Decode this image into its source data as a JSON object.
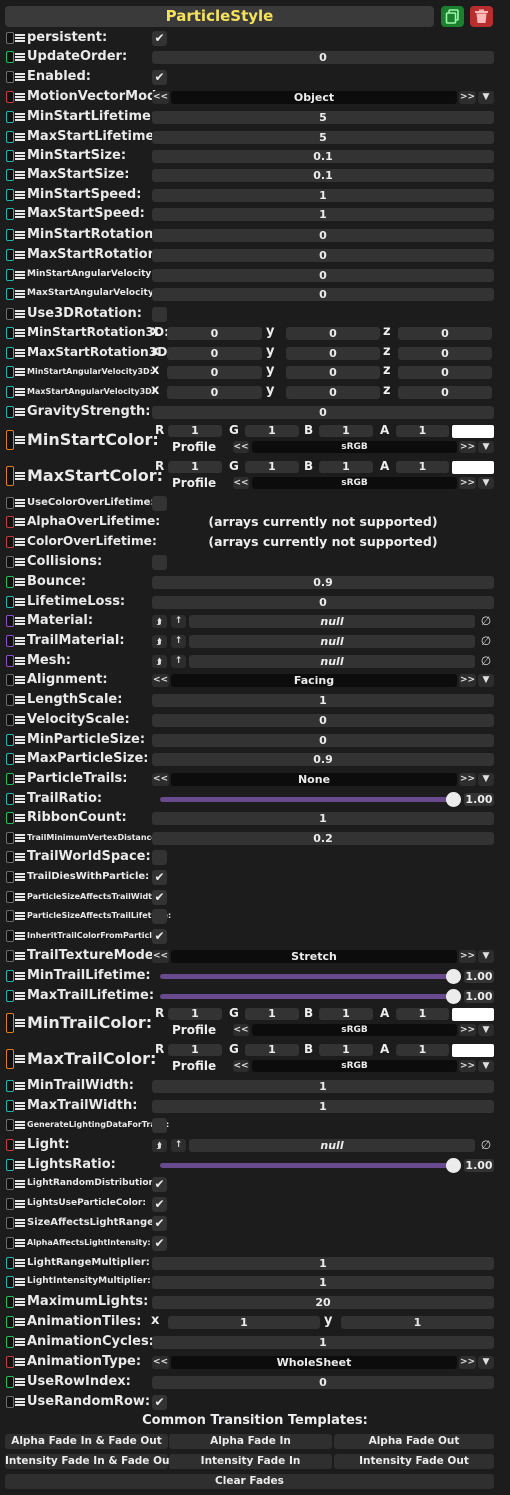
{
  "header": {
    "title": "ParticleStyle"
  },
  "toggle_colors": {
    "green": "#1fbe5a",
    "cyan": "#21b6b0",
    "red": "#c53a3a",
    "purple": "#8e4fcc",
    "orange": "#e07c1c",
    "gray": "#6c6c6c",
    "title_yellow": "#f5e25a"
  },
  "rows": [
    {
      "type": "check",
      "label": "persistent:",
      "checked": true
    },
    {
      "type": "field",
      "label": "UpdateOrder:",
      "value": "0"
    },
    {
      "type": "check",
      "label": "Enabled:",
      "checked": true
    },
    {
      "type": "dropdown",
      "label": "MotionVectorMode:",
      "value": "Object"
    },
    {
      "type": "field",
      "label": "MinStartLifetime:",
      "value": "5"
    },
    {
      "type": "field",
      "label": "MaxStartLifetime:",
      "value": "5"
    },
    {
      "type": "field",
      "label": "MinStartSize:",
      "value": "0.1"
    },
    {
      "type": "field",
      "label": "MaxStartSize:",
      "value": "0.1"
    },
    {
      "type": "field",
      "label": "MinStartSpeed:",
      "value": "1"
    },
    {
      "type": "field",
      "label": "MaxStartSpeed:",
      "value": "1"
    },
    {
      "type": "field",
      "label": "MinStartRotation:",
      "value": "0"
    },
    {
      "type": "field",
      "label": "MaxStartRotation:",
      "value": "0"
    },
    {
      "type": "field",
      "label": "MinStartAngularVelocity:",
      "value": "0"
    },
    {
      "type": "field",
      "label": "MaxStartAngularVelocity:",
      "value": "0"
    },
    {
      "type": "check",
      "label": "Use3DRotation:",
      "checked": false
    },
    {
      "type": "vec3",
      "label": "MinStartRotation3D:",
      "x": "0",
      "y": "0",
      "z": "0"
    },
    {
      "type": "vec3",
      "label": "MaxStartRotation3D:",
      "x": "0",
      "y": "0",
      "z": "0"
    },
    {
      "type": "vec3",
      "label": "MinStartAngularVelocity3D:",
      "x": "0",
      "y": "0",
      "z": "0"
    },
    {
      "type": "vec3",
      "label": "MaxStartAngularVelocity3D:",
      "x": "0",
      "y": "0",
      "z": "0"
    },
    {
      "type": "field",
      "label": "GravityStrength:",
      "value": "0"
    },
    {
      "type": "color",
      "label": "MinStartColor:",
      "r": "1",
      "g": "1",
      "b": "1",
      "a": "1",
      "profile_label": "Profile",
      "profile": "sRGB"
    },
    {
      "type": "color",
      "label": "MaxStartColor:",
      "r": "1",
      "g": "1",
      "b": "1",
      "a": "1",
      "profile_label": "Profile",
      "profile": "sRGB"
    },
    {
      "type": "check",
      "label": "UseColorOverLifetime:",
      "checked": false
    },
    {
      "type": "message",
      "label": "AlphaOverLifetime:",
      "message": "(arrays currently not supported)"
    },
    {
      "type": "message",
      "label": "ColorOverLifetime:",
      "message": "(arrays currently not supported)"
    },
    {
      "type": "check",
      "label": "Collisions:",
      "checked": false
    },
    {
      "type": "field",
      "label": "Bounce:",
      "value": "0.9"
    },
    {
      "type": "field",
      "label": "LifetimeLoss:",
      "value": "0"
    },
    {
      "type": "asset",
      "label": "Material:",
      "value": "null"
    },
    {
      "type": "asset",
      "label": "TrailMaterial:",
      "value": "null"
    },
    {
      "type": "asset",
      "label": "Mesh:",
      "value": "null"
    },
    {
      "type": "dropdown",
      "label": "Alignment:",
      "value": "Facing"
    },
    {
      "type": "field",
      "label": "LengthScale:",
      "value": "1"
    },
    {
      "type": "field",
      "label": "VelocityScale:",
      "value": "0"
    },
    {
      "type": "field",
      "label": "MinParticleSize:",
      "value": "0"
    },
    {
      "type": "field",
      "label": "MaxParticleSize:",
      "value": "0.9"
    },
    {
      "type": "dropdown",
      "label": "ParticleTrails:",
      "value": "None"
    },
    {
      "type": "slider",
      "label": "TrailRatio:",
      "value": "1.00",
      "fraction": 1.0
    },
    {
      "type": "field",
      "label": "RibbonCount:",
      "value": "1"
    },
    {
      "type": "field",
      "label": "TrailMinimumVertexDistance:",
      "value": "0.2"
    },
    {
      "type": "check",
      "label": "TrailWorldSpace:",
      "checked": false
    },
    {
      "type": "check",
      "label": "TrailDiesWithParticle:",
      "checked": true
    },
    {
      "type": "check",
      "label": "ParticleSizeAffectsTrailWidth:",
      "checked": true
    },
    {
      "type": "check",
      "label": "ParticleSizeAffectsTrailLifetime:",
      "checked": false
    },
    {
      "type": "check",
      "label": "InheritTrailColorFromParticle:",
      "checked": true
    },
    {
      "type": "dropdown",
      "label": "TrailTextureMode:",
      "value": "Stretch"
    },
    {
      "type": "slider",
      "label": "MinTrailLifetime:",
      "value": "1.00",
      "fraction": 1.0
    },
    {
      "type": "slider",
      "label": "MaxTrailLifetime:",
      "value": "1.00",
      "fraction": 1.0
    },
    {
      "type": "color",
      "label": "MinTrailColor:",
      "r": "1",
      "g": "1",
      "b": "1",
      "a": "1",
      "profile_label": "Profile",
      "profile": "sRGB"
    },
    {
      "type": "color",
      "label": "MaxTrailColor:",
      "r": "1",
      "g": "1",
      "b": "1",
      "a": "1",
      "profile_label": "Profile",
      "profile": "sRGB"
    },
    {
      "type": "field",
      "label": "MinTrailWidth:",
      "value": "1"
    },
    {
      "type": "field",
      "label": "MaxTrailWidth:",
      "value": "1"
    },
    {
      "type": "check",
      "label": "GenerateLightingDataForTrails:",
      "checked": false
    },
    {
      "type": "asset",
      "label": "Light:",
      "value": "null"
    },
    {
      "type": "slider",
      "label": "LightsRatio:",
      "value": "1.00",
      "fraction": 1.0
    },
    {
      "type": "check",
      "label": "LightRandomDistribution:",
      "checked": true
    },
    {
      "type": "check",
      "label": "LightsUseParticleColor:",
      "checked": true
    },
    {
      "type": "check",
      "label": "SizeAffectsLightRange:",
      "checked": true
    },
    {
      "type": "check",
      "label": "AlphaAffectsLightIntensity:",
      "checked": true
    },
    {
      "type": "field",
      "label": "LightRangeMultiplier:",
      "value": "1"
    },
    {
      "type": "field",
      "label": "LightIntensityMultiplier:",
      "value": "1"
    },
    {
      "type": "field",
      "label": "MaximumLights:",
      "value": "20"
    },
    {
      "type": "vec2",
      "label": "AnimationTiles:",
      "x": "1",
      "y": "1"
    },
    {
      "type": "field",
      "label": "AnimationCycles:",
      "value": "1"
    },
    {
      "type": "dropdown",
      "label": "AnimationType:",
      "value": "WholeSheet"
    },
    {
      "type": "field",
      "label": "UseRowIndex:",
      "value": "0"
    },
    {
      "type": "check",
      "label": "UseRandomRow:",
      "checked": true
    }
  ],
  "templates": {
    "title": "Common Transition Templates:",
    "buttons": [
      "Alpha Fade In & Fade Out",
      "Alpha Fade In",
      "Alpha Fade Out",
      "Intensity Fade In & Fade Out",
      "Intensity Fade In",
      "Intensity Fade Out"
    ],
    "clear": "Clear Fades"
  }
}
